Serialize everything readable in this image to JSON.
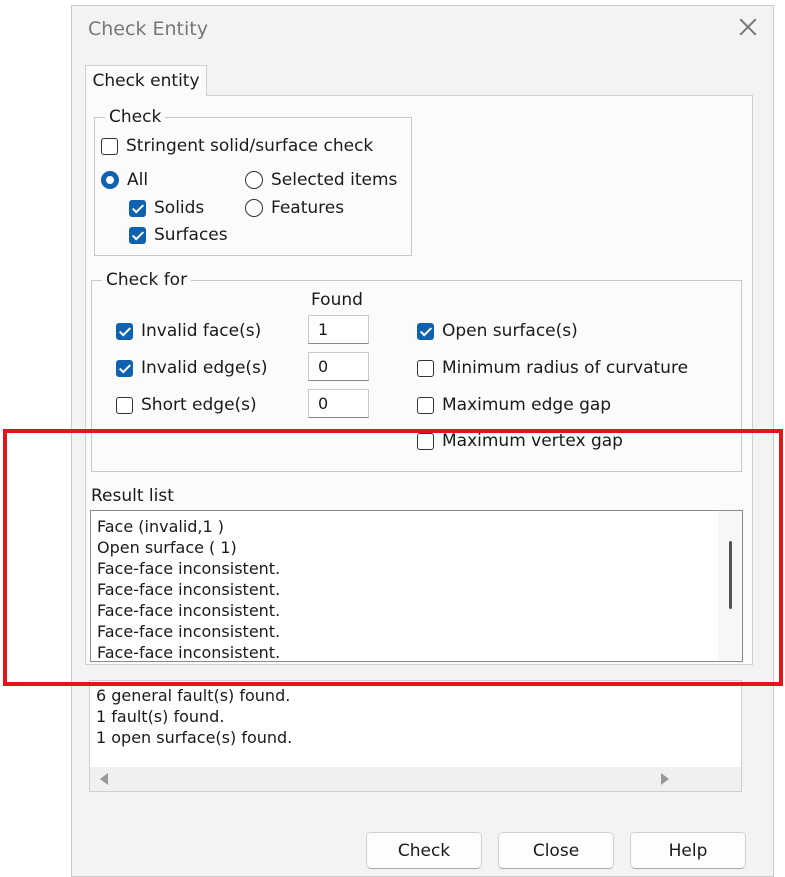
{
  "dialog": {
    "title": "Check Entity"
  },
  "tabs": [
    {
      "label": "Check entity"
    }
  ],
  "check_group": {
    "legend": "Check",
    "stringent": {
      "label": "Stringent solid/surface check",
      "checked": false
    },
    "radio_all": {
      "label": "All",
      "selected": true
    },
    "radio_selected": {
      "label": "Selected items",
      "selected": false
    },
    "radio_features": {
      "label": "Features",
      "selected": false
    },
    "solids": {
      "label": "Solids",
      "checked": true
    },
    "surfaces": {
      "label": "Surfaces",
      "checked": true
    }
  },
  "check_for": {
    "legend": "Check for",
    "found_header": "Found",
    "invalid_faces": {
      "label": "Invalid face(s)",
      "checked": true,
      "found": "1"
    },
    "invalid_edges": {
      "label": "Invalid edge(s)",
      "checked": true,
      "found": "0"
    },
    "short_edges": {
      "label": "Short edge(s)",
      "checked": false,
      "found": "0"
    },
    "open_surfaces": {
      "label": "Open surface(s)",
      "checked": true
    },
    "min_radius": {
      "label": "Minimum radius of curvature",
      "checked": false
    },
    "max_edge_gap": {
      "label": "Maximum edge gap",
      "checked": false
    },
    "max_vertex_gap": {
      "label": "Maximum vertex gap",
      "checked": false
    }
  },
  "result_list": {
    "label": "Result list",
    "items": [
      "Face (invalid,1  )",
      "Open surface (  1)",
      "Face-face inconsistent.",
      "Face-face inconsistent.",
      "Face-face inconsistent.",
      "Face-face inconsistent.",
      "Face-face inconsistent."
    ]
  },
  "summary": {
    "lines": [
      "6 general fault(s) found.",
      "1 fault(s) found.",
      "1 open surface(s) found."
    ]
  },
  "buttons": {
    "check": "Check",
    "close": "Close",
    "help": "Help"
  },
  "colors": {
    "accent": "#0f62b0",
    "highlight_box": "#e0161b"
  },
  "icons": [
    "close-icon",
    "checkbox-icon",
    "radio-icon",
    "scroll-left-icon",
    "scroll-right-icon"
  ]
}
